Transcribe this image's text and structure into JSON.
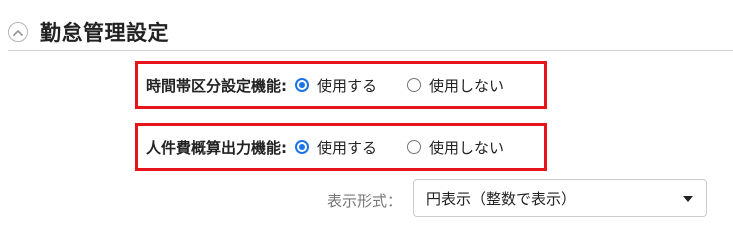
{
  "section": {
    "title": "勤怠管理設定",
    "collapse_icon": "chevron-up-circle-icon"
  },
  "settings": [
    {
      "label": "時間帯区分設定機能:",
      "options": [
        {
          "label": "使用する",
          "checked": true
        },
        {
          "label": "使用しない",
          "checked": false
        }
      ]
    },
    {
      "label": "人件費概算出力機能:",
      "options": [
        {
          "label": "使用する",
          "checked": true
        },
        {
          "label": "使用しない",
          "checked": false
        }
      ]
    }
  ],
  "display_format": {
    "label": "表示形式：",
    "selected": "円表示（整数で表示）"
  },
  "colors": {
    "highlight_border": "#e8141c",
    "radio_accent": "#1a73e8"
  }
}
